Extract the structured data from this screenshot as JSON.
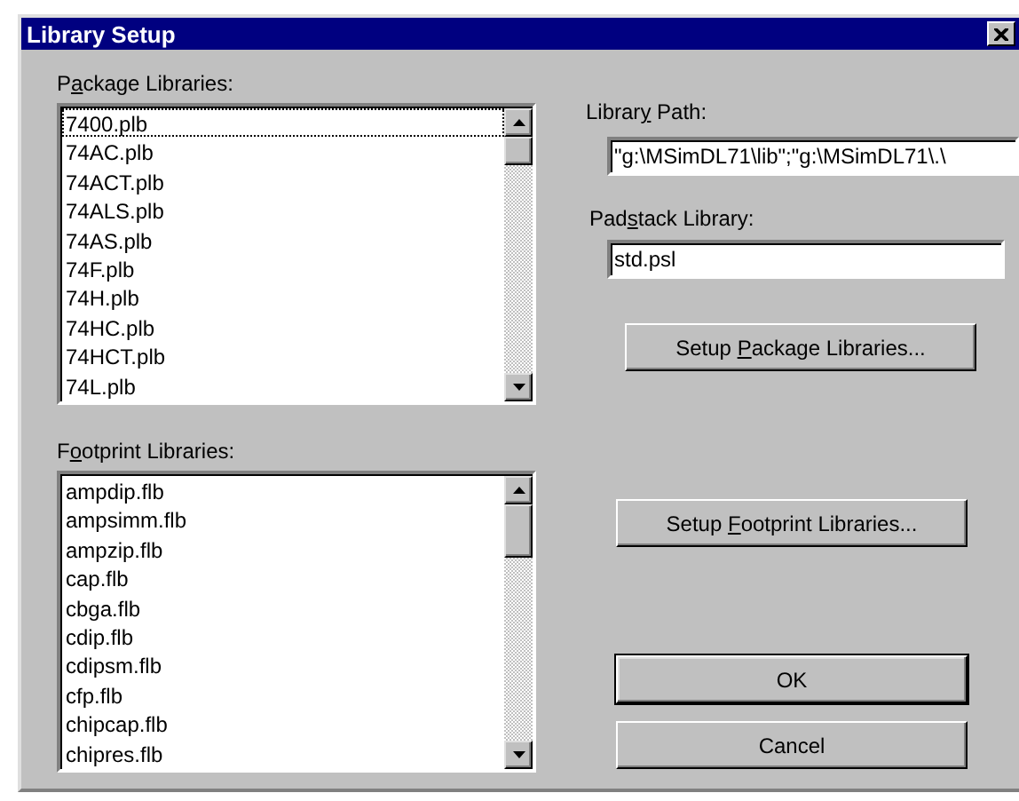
{
  "window": {
    "title": "Library Setup"
  },
  "package_libraries": {
    "label": [
      "P",
      "a",
      "ckage Libraries:"
    ],
    "items": [
      {
        "text": "7400.plb",
        "selected": true
      },
      {
        "text": "74AC.plb",
        "selected": false
      },
      {
        "text": "74ACT.plb",
        "selected": false
      },
      {
        "text": "74ALS.plb",
        "selected": false
      },
      {
        "text": "74AS.plb",
        "selected": false
      },
      {
        "text": "74F.plb",
        "selected": false
      },
      {
        "text": "74H.plb",
        "selected": false
      },
      {
        "text": "74HC.plb",
        "selected": false
      },
      {
        "text": "74HCT.plb",
        "selected": false
      },
      {
        "text": "74L.plb",
        "selected": false
      }
    ]
  },
  "footprint_libraries": {
    "label": [
      "F",
      "o",
      "otprint Libraries:"
    ],
    "items": [
      {
        "text": "ampdip.flb",
        "selected": false
      },
      {
        "text": "ampsimm.flb",
        "selected": false
      },
      {
        "text": "ampzip.flb",
        "selected": false
      },
      {
        "text": "cap.flb",
        "selected": false
      },
      {
        "text": "cbga.flb",
        "selected": false
      },
      {
        "text": "cdip.flb",
        "selected": false
      },
      {
        "text": "cdipsm.flb",
        "selected": false
      },
      {
        "text": "cfp.flb",
        "selected": false
      },
      {
        "text": "chipcap.flb",
        "selected": false
      },
      {
        "text": "chipres.flb",
        "selected": false
      }
    ]
  },
  "library_path": {
    "label": [
      "Librar",
      "y",
      " Path:"
    ],
    "value": "\"g:\\MSimDL71\\lib\";\"g:\\MSimDL71\\.\\"
  },
  "padstack_library": {
    "label": [
      "Pad",
      "s",
      "tack Library:"
    ],
    "value": "std.psl"
  },
  "buttons": [
    {
      "label": [
        "Setup ",
        "P",
        "ackage Libraries..."
      ],
      "default": false
    },
    {
      "label": [
        "Setup ",
        "F",
        "ootprint Libraries..."
      ],
      "default": false
    },
    {
      "label": [
        "OK"
      ],
      "default": true
    },
    {
      "label": [
        "Cancel"
      ],
      "default": false
    }
  ]
}
